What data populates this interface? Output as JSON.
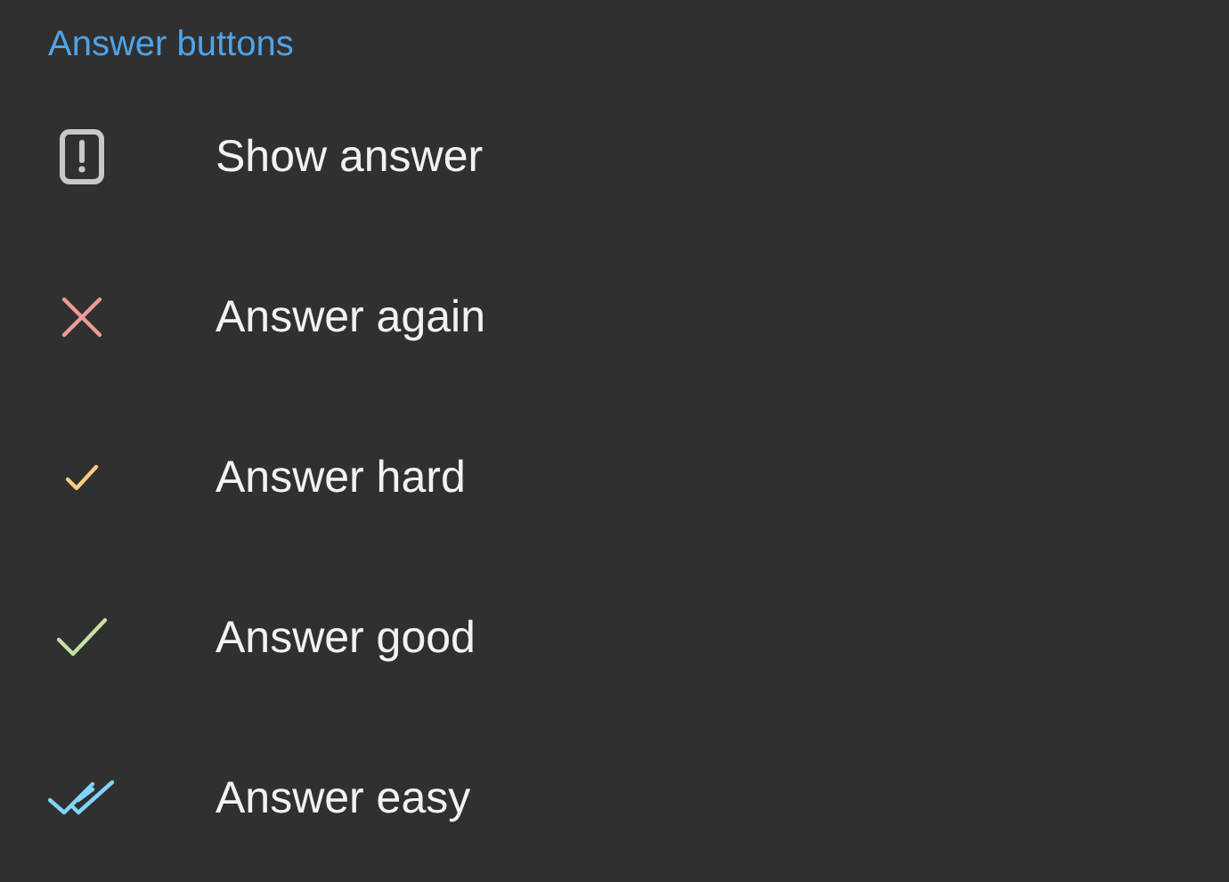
{
  "section": {
    "title": "Answer buttons"
  },
  "items": [
    {
      "label": "Show answer",
      "kind": "show",
      "color": "#c8c8c8"
    },
    {
      "label": "Answer again",
      "kind": "again",
      "color": "#ef9a9a"
    },
    {
      "label": "Answer hard",
      "kind": "hard",
      "color": "#ffcc80"
    },
    {
      "label": "Answer good",
      "kind": "good",
      "color": "#c5e1a5"
    },
    {
      "label": "Answer easy",
      "kind": "easy",
      "color": "#81d4fa"
    }
  ]
}
